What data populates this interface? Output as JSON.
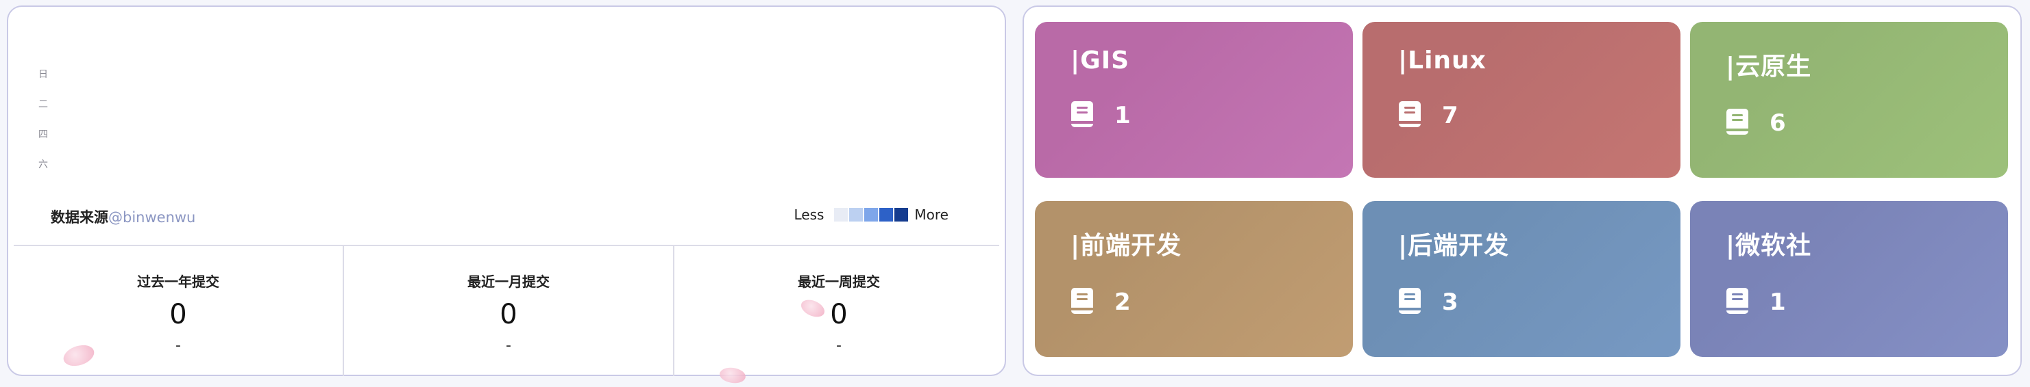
{
  "calendar": {
    "weekdays": [
      "日",
      "二",
      "四",
      "六"
    ],
    "source_label": "数据来源",
    "source_author": "@binwenwu",
    "legend_less": "Less",
    "legend_more": "More",
    "legend_colors": [
      "#e8ecf5",
      "#bcd0f1",
      "#7ea6ea",
      "#2d61c7",
      "#153c8f"
    ]
  },
  "stats": [
    {
      "title": "过去一年提交",
      "value": "0",
      "sub": "-"
    },
    {
      "title": "最近一月提交",
      "value": "0",
      "sub": "-"
    },
    {
      "title": "最近一周提交",
      "value": "0",
      "sub": "-"
    }
  ],
  "categories": [
    {
      "name": "|GIS",
      "count": "1",
      "color_a": "#b96aa7",
      "color_b": "#c476b4"
    },
    {
      "name": "|Linux",
      "count": "7",
      "color_a": "#b86d6e",
      "color_b": "#c57672"
    },
    {
      "name": "|云原生",
      "count": "6",
      "color_a": "#93b573",
      "color_b": "#9dc17a"
    },
    {
      "name": "|前端开发",
      "count": "2",
      "color_a": "#b3926a",
      "color_b": "#c19d72"
    },
    {
      "name": "|后端开发",
      "count": "3",
      "color_a": "#6d8fb5",
      "color_b": "#7799c3"
    },
    {
      "name": "|微软社",
      "count": "1",
      "color_a": "#7a83b7",
      "color_b": "#8590c5"
    }
  ]
}
